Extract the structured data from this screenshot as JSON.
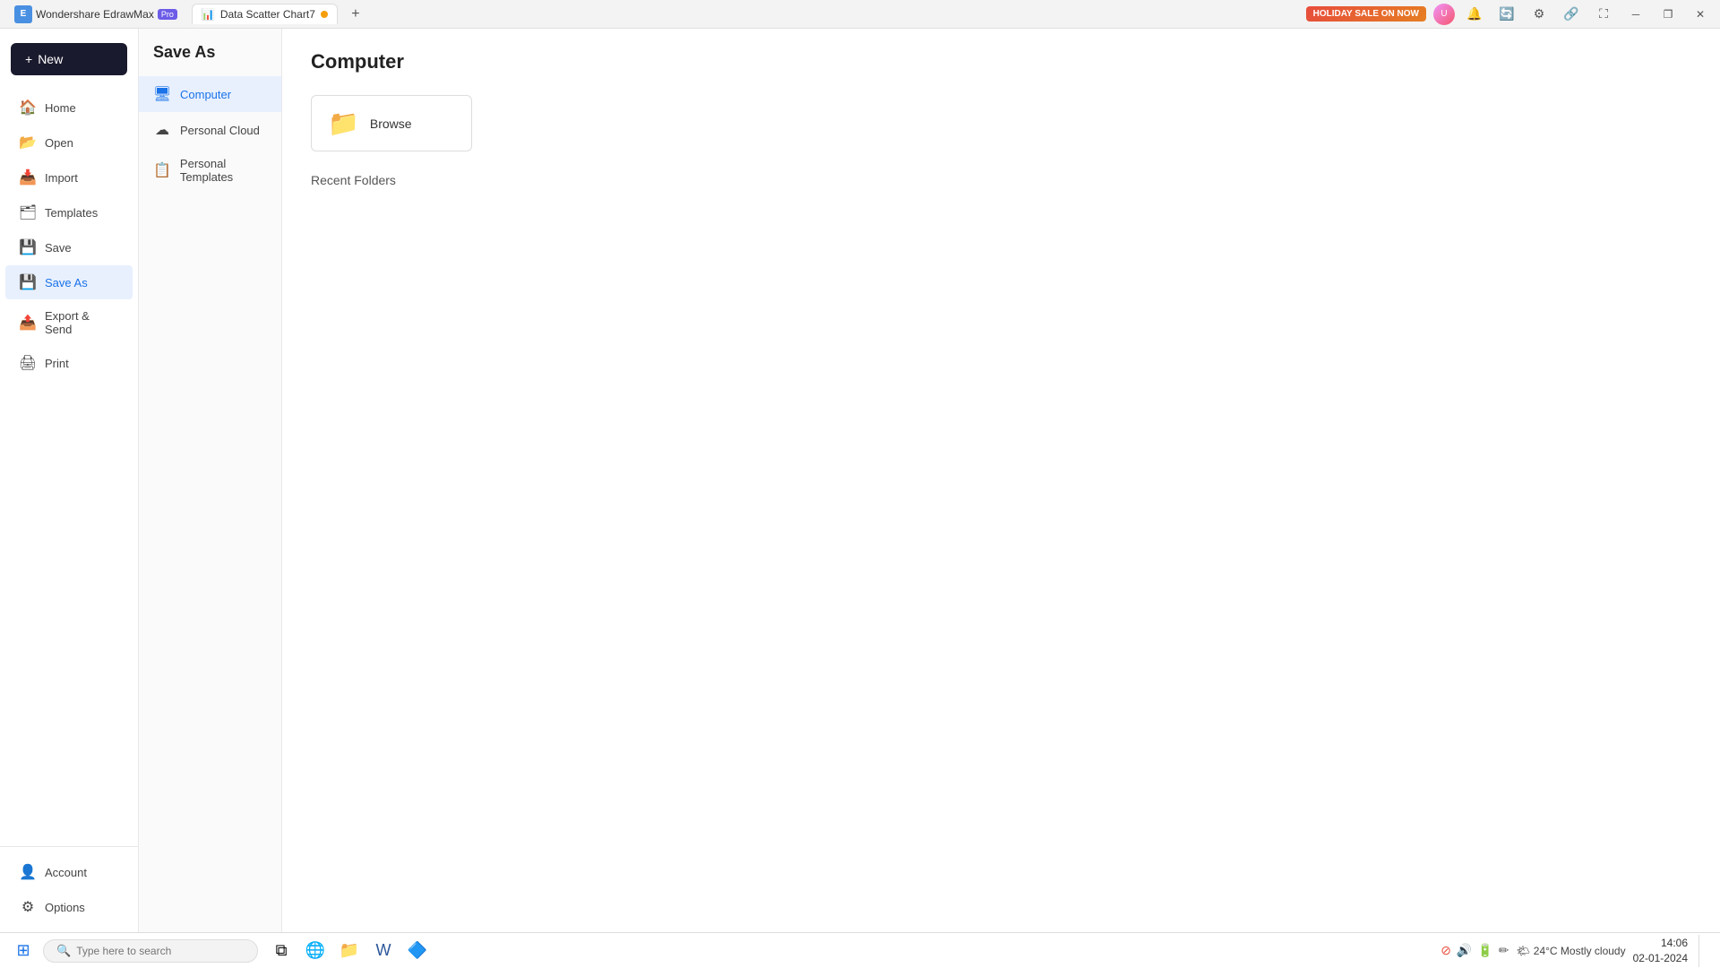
{
  "titlebar": {
    "app_name": "Wondershare EdrawMax",
    "pro_label": "Pro",
    "tab_label": "Data Scatter Chart7",
    "tab_modified": true,
    "add_tab": "+",
    "holiday_btn": "HOLIDAY SALE ON NOW",
    "minimize": "─",
    "maximize": "❐",
    "close": "✕"
  },
  "new_button": {
    "label": "New",
    "icon": "+"
  },
  "sidebar": {
    "items": [
      {
        "id": "home",
        "label": "Home",
        "icon": "🏠"
      },
      {
        "id": "open",
        "label": "Open",
        "icon": "📂"
      },
      {
        "id": "import",
        "label": "Import",
        "icon": "📥"
      },
      {
        "id": "templates",
        "label": "Templates",
        "icon": "🗂"
      },
      {
        "id": "save",
        "label": "Save",
        "icon": "💾"
      },
      {
        "id": "save-as",
        "label": "Save As",
        "icon": "💾",
        "active": true
      },
      {
        "id": "export-send",
        "label": "Export & Send",
        "icon": "📤"
      },
      {
        "id": "print",
        "label": "Print",
        "icon": "🖨"
      }
    ],
    "bottom_items": [
      {
        "id": "account",
        "label": "Account",
        "icon": "👤"
      },
      {
        "id": "options",
        "label": "Options",
        "icon": "⚙"
      }
    ]
  },
  "save_as": {
    "title": "Save As",
    "items": [
      {
        "id": "computer",
        "label": "Computer",
        "icon": "🖥",
        "active": true
      },
      {
        "id": "personal-cloud",
        "label": "Personal Cloud",
        "icon": "☁"
      },
      {
        "id": "personal-templates",
        "label": "Personal Templates",
        "icon": "📋"
      }
    ]
  },
  "content": {
    "title": "Computer",
    "browse_label": "Browse",
    "recent_folders_label": "Recent Folders"
  },
  "taskbar": {
    "search_placeholder": "Type here to search",
    "apps": [
      "🔲",
      "🌐",
      "📁",
      "📝",
      "🔷"
    ],
    "weather": "24°C  Mostly cloudy",
    "time": "14:06",
    "date": "02-01-2024"
  }
}
